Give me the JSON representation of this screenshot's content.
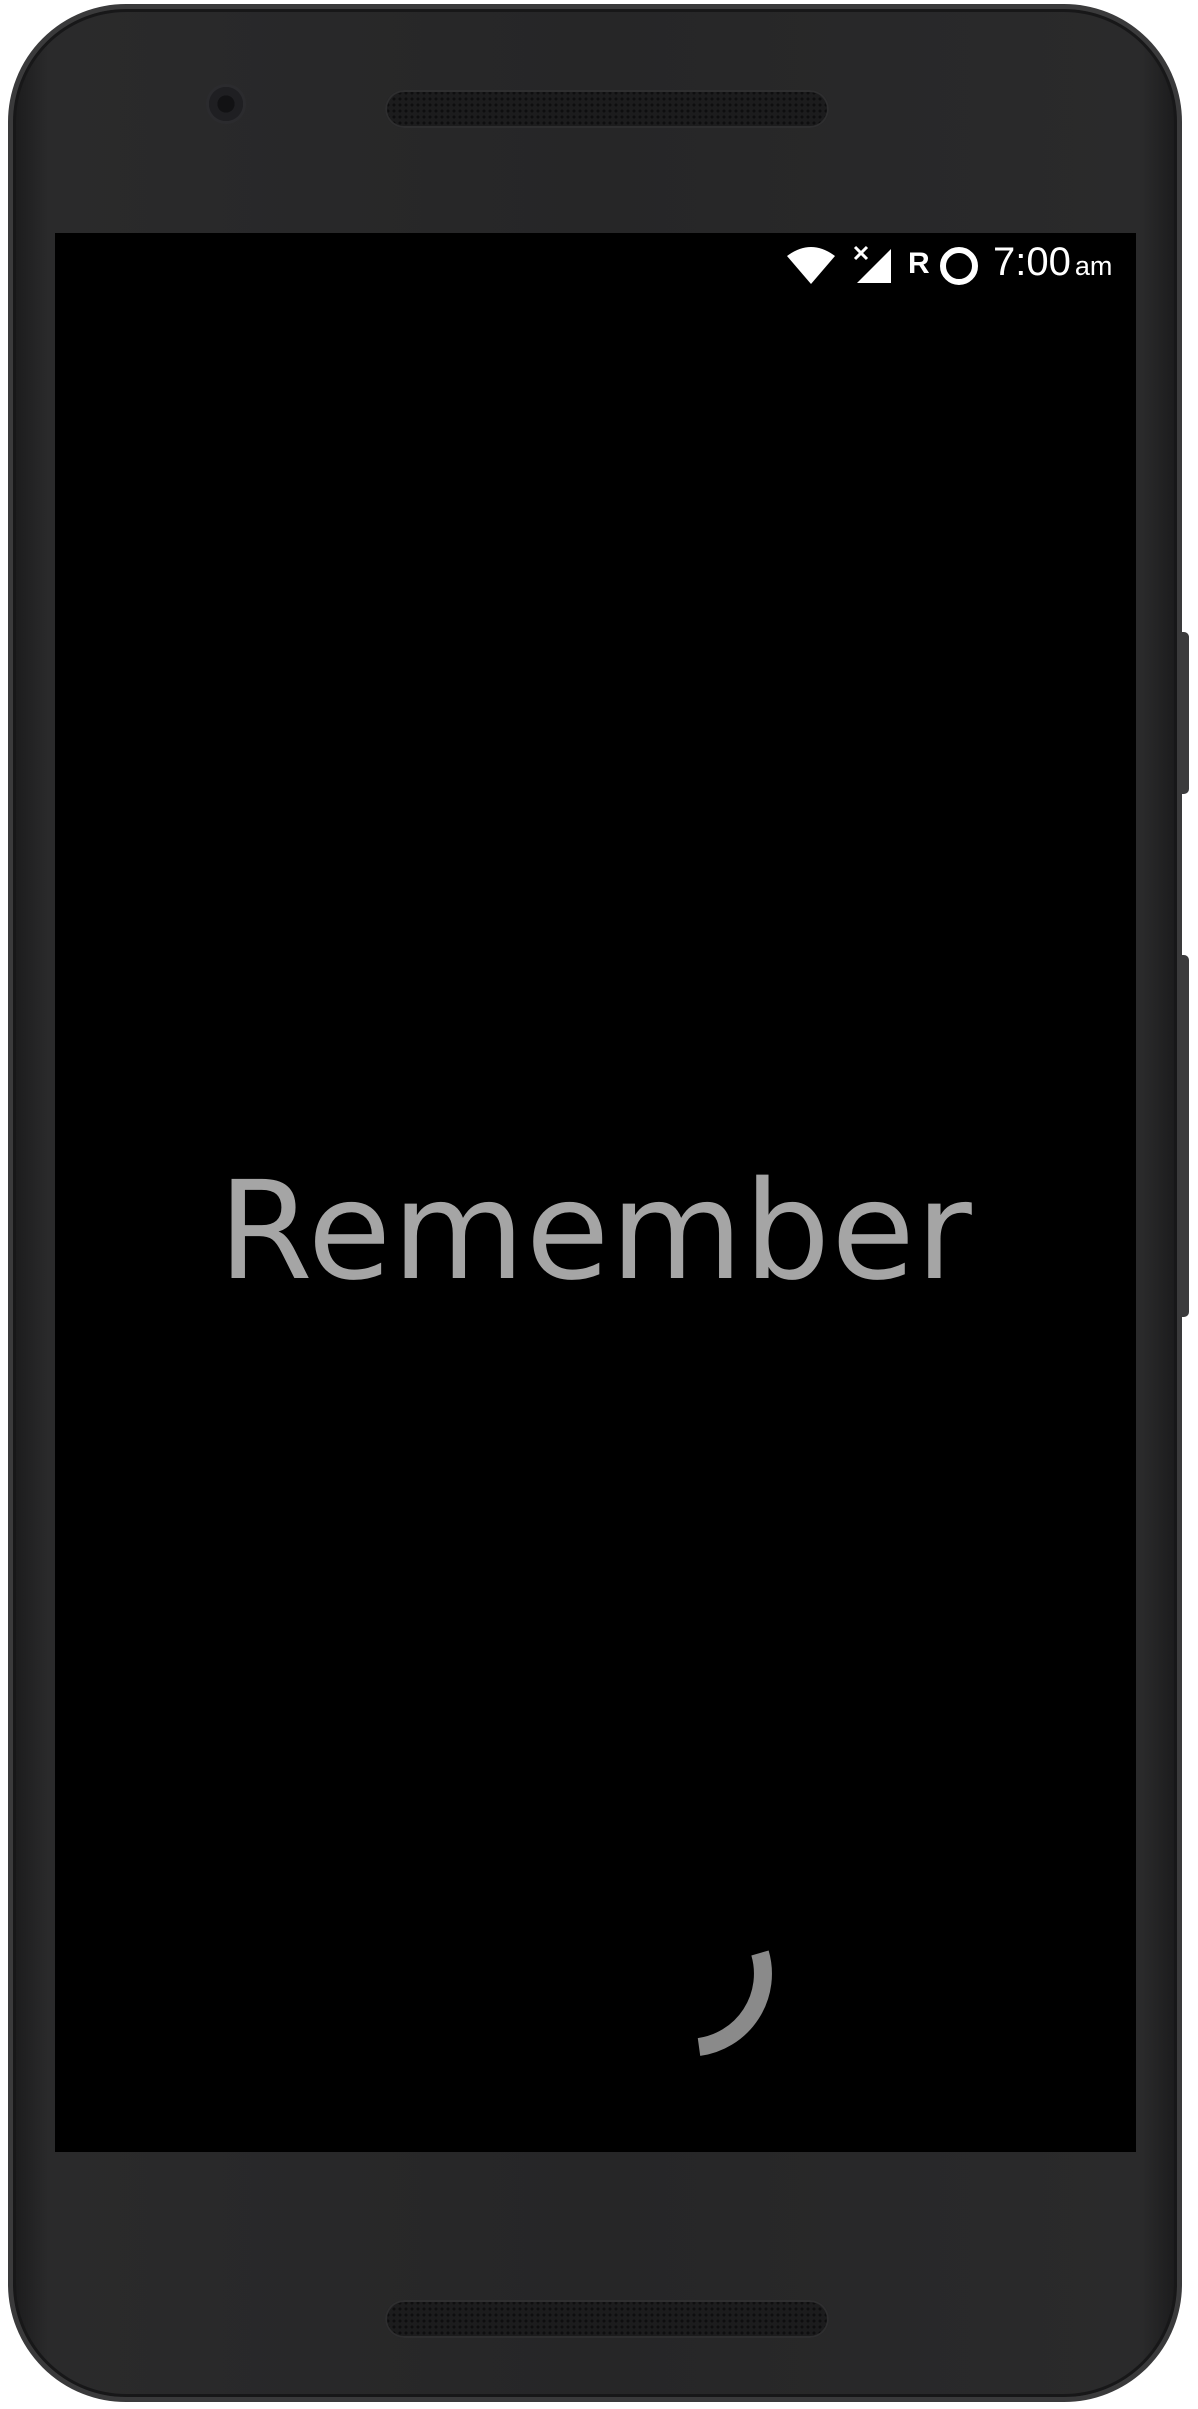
{
  "status_bar": {
    "wifi_icon": "wifi-icon",
    "signal_icon": "cell-signal-no-data-icon",
    "roaming_label": "R",
    "circle_icon": "ring-icon",
    "time": "7:00",
    "meridiem": "am"
  },
  "splash": {
    "title": "Remember"
  },
  "loading": {
    "icon": "loading-spinner-icon",
    "color": "#8a8a8a"
  },
  "colors": {
    "screen_background": "#000000",
    "title_color": "#a5a5a5",
    "device_body": "#262627"
  }
}
